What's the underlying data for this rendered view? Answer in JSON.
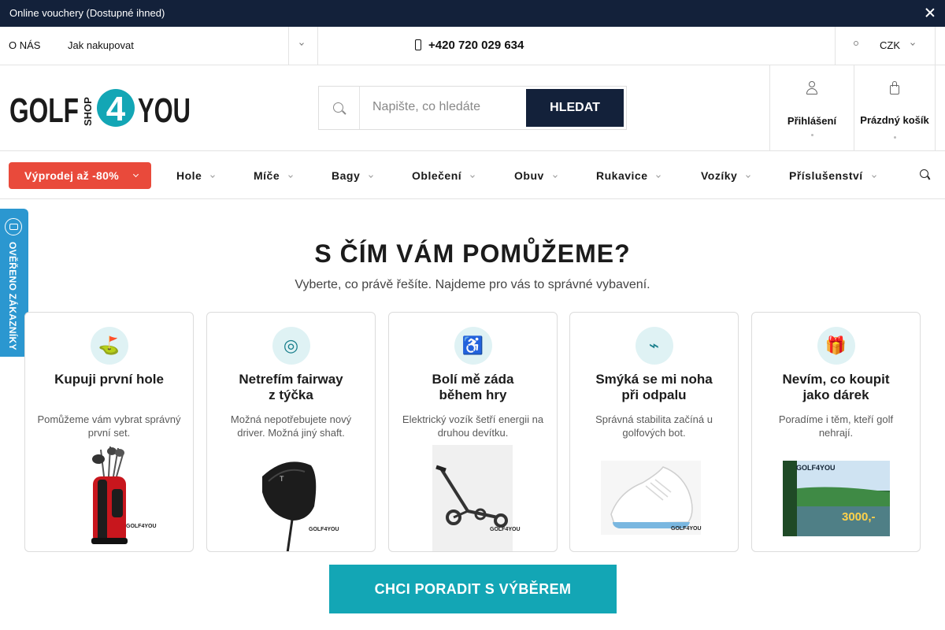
{
  "promo": {
    "text": " Online vouchery (Dostupné ihned)"
  },
  "topbar": {
    "links": [
      "O NÁS",
      "Jak nakupovat"
    ],
    "phone": "+420 720 029 634",
    "currency": "CZK"
  },
  "header": {
    "logo_left": "GOLF",
    "logo_shop": "SHOP",
    "logo_num": "4",
    "logo_right": "YOU",
    "search_placeholder": "Napište, co hledáte",
    "search_button": "HLEDAT",
    "login_label": "Přihlášení",
    "cart_label": "Prázdný košík"
  },
  "nav": {
    "sale": "Výprodej až -80%",
    "items": [
      "Hole",
      "Míče",
      "Bagy",
      "Oblečení",
      "Obuv",
      "Rukavice",
      "Vozíky",
      "Příslušenství"
    ]
  },
  "badge": {
    "text": "OVĚŘENO ZÁKAZNÍKY"
  },
  "main": {
    "title": "S ČÍM VÁM POMŮŽEME?",
    "subtitle": "Vyberte, co právě řešíte. Najdeme pro vás to správné vybavení.",
    "cards": [
      {
        "icon": "golf-flag-icon",
        "glyph": "⛳",
        "title_l1": "Kupuji první hole",
        "title_l2": "",
        "desc": "Pomůžeme vám vybrat správný první set."
      },
      {
        "icon": "target-icon",
        "glyph": "◎",
        "title_l1": "Netrefím fairway",
        "title_l2": "z týčka",
        "desc": "Možná nepotřebujete nový driver. Možná jiný shaft."
      },
      {
        "icon": "wheelchair-icon",
        "glyph": "♿",
        "title_l1": "Bolí mě záda",
        "title_l2": "během hry",
        "desc": "Elektrický vozík šetří energii na druhou devítku."
      },
      {
        "icon": "shoe-icon",
        "glyph": "⌁",
        "title_l1": "Smýká se mi noha",
        "title_l2": "při odpalu",
        "desc": "Správná stabilita začíná u golfových bot."
      },
      {
        "icon": "gift-icon",
        "glyph": "🎁",
        "title_l1": "Nevím, co koupit",
        "title_l2": "jako dárek",
        "desc": "Poradíme i těm, kteří golf nehrají."
      }
    ],
    "brand_watermark": "GOLF4YOU",
    "voucher_price": "3000,-",
    "cta": "CHCI PORADIT S VÝBĚREM"
  },
  "colors": {
    "navy": "#13213a",
    "sale_red": "#e94a3b",
    "teal": "#13a6b5",
    "badge_blue": "#2b97d0",
    "icon_bg": "#dff2f4"
  }
}
